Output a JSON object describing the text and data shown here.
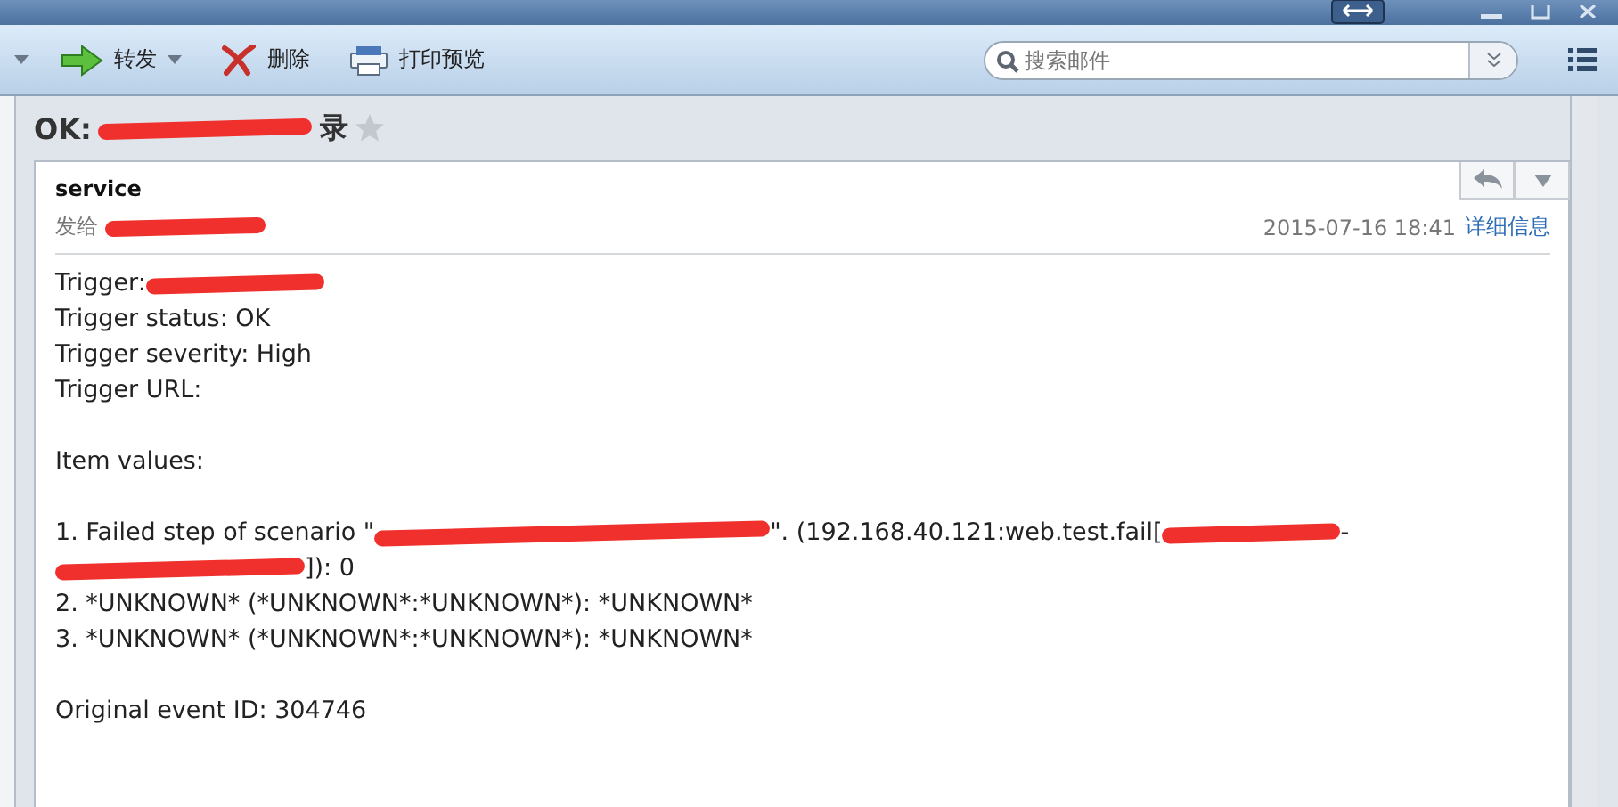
{
  "toolbar": {
    "buttons": [
      {
        "label": "转发",
        "kind": "forward",
        "dropdown": true
      },
      {
        "label": "删除",
        "kind": "delete",
        "dropdown": false
      },
      {
        "label": "打印预览",
        "kind": "print",
        "dropdown": false
      }
    ],
    "search": {
      "placeholder": "搜索邮件"
    }
  },
  "subject": {
    "parts": [
      {
        "kind": "text",
        "text": "OK:"
      },
      {
        "kind": "redaction"
      },
      {
        "kind": "text",
        "text": "录"
      }
    ],
    "starred": false
  },
  "message": {
    "sender": "service",
    "recipient": [
      {
        "kind": "text",
        "text": "发给"
      },
      {
        "kind": "redaction"
      }
    ],
    "date": "2015-07-16 18:41",
    "details_link": "详细信息",
    "body": [
      {
        "kind": "line",
        "parts": [
          {
            "kind": "text",
            "text": "Trigger:"
          },
          {
            "kind": "redaction"
          }
        ]
      },
      {
        "kind": "line",
        "parts": [
          {
            "kind": "text",
            "text": "Trigger status: OK"
          }
        ]
      },
      {
        "kind": "line",
        "parts": [
          {
            "kind": "text",
            "text": "Trigger severity: High"
          }
        ]
      },
      {
        "kind": "line",
        "parts": [
          {
            "kind": "text",
            "text": "Trigger URL:"
          }
        ]
      },
      {
        "kind": "blank"
      },
      {
        "kind": "line",
        "parts": [
          {
            "kind": "text",
            "text": "Item values:"
          }
        ]
      },
      {
        "kind": "blank"
      },
      {
        "kind": "line",
        "parts": [
          {
            "kind": "text",
            "text": "1. Failed step of scenario \""
          },
          {
            "kind": "redaction"
          },
          {
            "kind": "text",
            "text": "\". (192.168.40.121:web.test.fail["
          },
          {
            "kind": "redaction"
          },
          {
            "kind": "text",
            "text": "-"
          }
        ]
      },
      {
        "kind": "line",
        "parts": [
          {
            "kind": "redaction"
          },
          {
            "kind": "text",
            "text": "]): 0"
          }
        ]
      },
      {
        "kind": "line",
        "parts": [
          {
            "kind": "text",
            "text": "2. *UNKNOWN* (*UNKNOWN*:*UNKNOWN*): *UNKNOWN*"
          }
        ]
      },
      {
        "kind": "line",
        "parts": [
          {
            "kind": "text",
            "text": "3. *UNKNOWN* (*UNKNOWN*:*UNKNOWN*): *UNKNOWN*"
          }
        ]
      },
      {
        "kind": "blank"
      },
      {
        "kind": "line",
        "parts": [
          {
            "kind": "text",
            "text": "Original event ID: 304746"
          }
        ]
      }
    ]
  }
}
